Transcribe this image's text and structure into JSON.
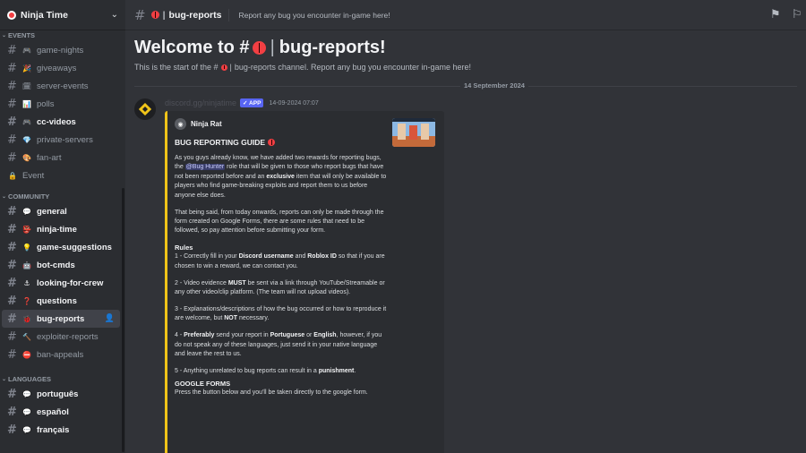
{
  "server": {
    "name": "Ninja Time"
  },
  "sidebar": {
    "categories": [
      {
        "name": "EVENTS",
        "channels": [
          {
            "name": "game-nights",
            "icon": "gamepad-icon",
            "glyph": "🎮",
            "bold": false
          },
          {
            "name": "giveaways",
            "icon": "party-icon",
            "glyph": "🎉",
            "bold": false
          },
          {
            "name": "server-events",
            "icon": "calendar-icon",
            "glyph": "🗓",
            "bold": false
          },
          {
            "name": "polls",
            "icon": "chart-icon",
            "glyph": "📊",
            "bold": false
          },
          {
            "name": "cc-videos",
            "icon": "controller-icon",
            "glyph": "🎮",
            "bold": true
          },
          {
            "name": "private-servers",
            "icon": "gem-icon",
            "glyph": "💎",
            "bold": false
          },
          {
            "name": "fan-art",
            "icon": "palette-icon",
            "glyph": "🎨",
            "bold": false
          },
          {
            "name": "Event",
            "icon": "lock-icon",
            "glyph": "🔒",
            "bold": false,
            "voice": true
          }
        ]
      },
      {
        "name": "COMMUNITY",
        "channels": [
          {
            "name": "general",
            "icon": "speech-icon",
            "glyph": "💬",
            "bold": true
          },
          {
            "name": "ninja-time",
            "icon": "ninja-icon",
            "glyph": "👺",
            "bold": true
          },
          {
            "name": "game-suggestions",
            "icon": "bulb-icon",
            "glyph": "💡",
            "bold": true
          },
          {
            "name": "bot-cmds",
            "icon": "robot-icon",
            "glyph": "🤖",
            "bold": true
          },
          {
            "name": "looking-for-crew",
            "icon": "anchor-icon",
            "glyph": "⚓",
            "bold": true
          },
          {
            "name": "questions",
            "icon": "question-icon",
            "glyph": "❓",
            "bold": true
          },
          {
            "name": "bug-reports",
            "icon": "ladybug-icon",
            "glyph": "🐞",
            "bold": true,
            "active": true
          },
          {
            "name": "exploiter-reports",
            "icon": "hammer-icon",
            "glyph": "🔨",
            "bold": false
          },
          {
            "name": "ban-appeals",
            "icon": "cone-icon",
            "glyph": "⛔",
            "bold": false
          }
        ]
      },
      {
        "name": "LANGUAGES",
        "channels": [
          {
            "name": "português",
            "icon": "speech-icon",
            "glyph": "💬",
            "bold": true
          },
          {
            "name": "español",
            "icon": "speech-icon",
            "glyph": "💬",
            "bold": true
          },
          {
            "name": "français",
            "icon": "speech-icon",
            "glyph": "💬",
            "bold": true
          }
        ]
      }
    ]
  },
  "topbar": {
    "channel_name": "bug-reports",
    "topic": "Report any bug you encounter in-game here!"
  },
  "main": {
    "welcome_prefix": "Welcome to #",
    "welcome_suffix": "bug-reports!",
    "sub_prefix": "This is the start of the #",
    "sub_suffix": "bug-reports channel. Report any bug you encounter in-game here!",
    "date_divider": "14 September 2024",
    "message": {
      "author": "discord.gg/ninjatime",
      "badge": "✓ APP",
      "timestamp": "14-09-2024 07:07",
      "embed": {
        "author_name": "Ninja Rat",
        "title": "BUG REPORTING GUIDE",
        "p1_a": "As you guys already know, we have added two rewards for reporting bugs, the ",
        "p1_mention": "@Bug Hunter",
        "p1_b": " role that will be given to those who report bugs that have not been reported before and an ",
        "p1_bold": "exclusive",
        "p1_c": " item that will only be available to players who find game-breaking exploits and report them to us before anyone else does.",
        "p2": "That being said, from today onwards, reports can only be made through the form created on Google Forms, there are some rules that need to be followed, so pay attention before submitting your form.",
        "rules_heading": "Rules",
        "r1_a": "1 - Correctly fill in your ",
        "r1_b1": "Discord username",
        "r1_and": " and ",
        "r1_b2": "Roblox ID",
        "r1_c": " so that if you are chosen to win a reward, we can contact you.",
        "r2_a": "2 - Video evidence ",
        "r2_b": "MUST",
        "r2_c": " be sent via a link through YouTube/Streamable or any other video/clip platform. (The team will not upload videos).",
        "r3_a": "3 - Explanations/descriptions of how the bug occurred or how to reproduce it are welcome, but ",
        "r3_b": "NOT",
        "r3_c": " necessary.",
        "r4_a": "4 - ",
        "r4_b": "Preferably",
        "r4_c": " send your report in ",
        "r4_d": "Portuguese",
        "r4_or": " or ",
        "r4_e": "English",
        "r4_f": ", however, if you do not speak any of these languages, just send it in your native language and leave the rest to us.",
        "r5_a": "5 - Anything unrelated to bug reports can result in a ",
        "r5_b": "punishment",
        "r5_c": ".",
        "forms_heading": "GOOGLE FORMS",
        "forms_text": "Press the button below and you'll be taken directly to the google form."
      }
    }
  },
  "colors": {
    "accent": "#5865f2",
    "embed_bar": "#f0c419",
    "bug_red": "#f23f43"
  }
}
